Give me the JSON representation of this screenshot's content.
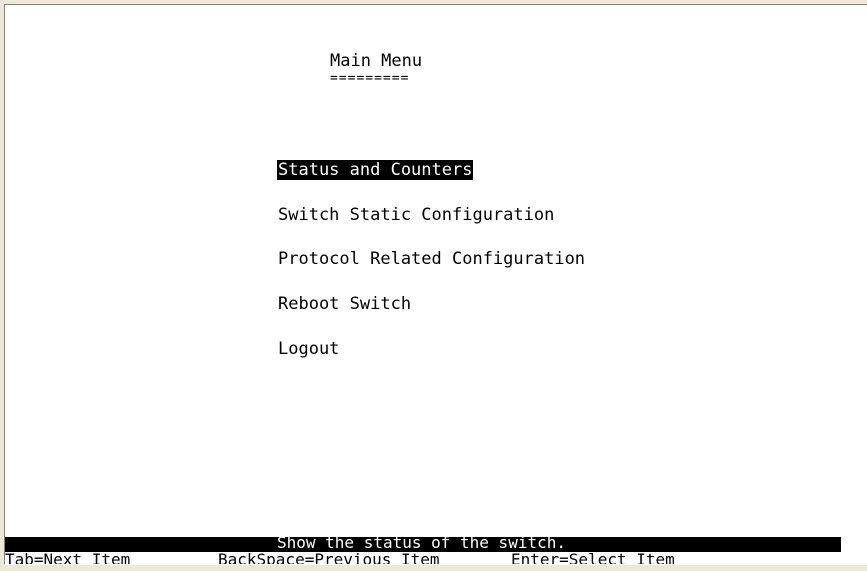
{
  "screen": {
    "title": "Main Menu",
    "title_underline": "========="
  },
  "menu": {
    "items": [
      {
        "label": "Status and Counters",
        "selected": true
      },
      {
        "label": "Switch Static Configuration",
        "selected": false
      },
      {
        "label": "Protocol Related Configuration",
        "selected": false
      },
      {
        "label": "Reboot Switch",
        "selected": false
      },
      {
        "label": "Logout",
        "selected": false
      }
    ]
  },
  "status": {
    "help_text": "Show the status of the switch."
  },
  "keys": {
    "tab": "Tab=Next Item",
    "backspace": "BackSpace=Previous Item",
    "enter": "Enter=Select Item"
  },
  "colors": {
    "background": "#ffffff",
    "text": "#000000",
    "highlight": "#000000",
    "highlight_text": "#ffffff"
  }
}
